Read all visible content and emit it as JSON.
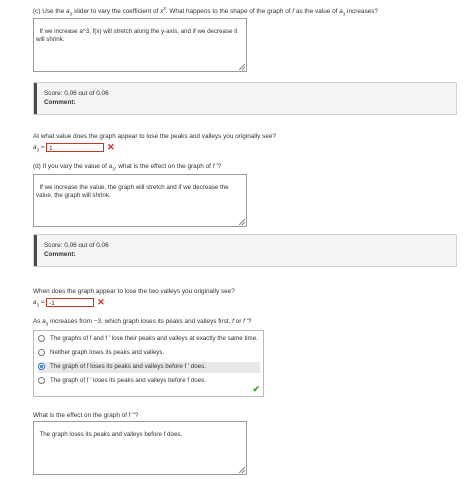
{
  "part_c": {
    "prefix": "(c) Use the ",
    "a": "a",
    "sub": "3",
    "mid": " slider to vary the coefficient of ",
    "x": "x",
    "sup": "3",
    "rest": ". What happens to the shape of the graph of ",
    "f": "f",
    "rest2": " as the value of ",
    "a2": "a",
    "sub2": "3",
    "end": " increases?",
    "answer": "If we increase a^3, f(x) will stretch along the y-axis, and if we decrease it will shrink."
  },
  "score1": {
    "text": "Score: 0.06 out of 0.06",
    "comment_label": "Comment:"
  },
  "q_peaks": {
    "text": "At what value does the graph appear to lose the peaks and valleys you originally see?",
    "var_a": "a",
    "var_sub": "3",
    "approx": " ≈ ",
    "value": "1"
  },
  "part_d": {
    "prefix": "(d) If you vary the value of ",
    "a": "a",
    "sub": "3",
    "mid": ", what is the effect on the graph of ",
    "fp": "f ′",
    "end": "?",
    "answer": "If we increase the value, the graph will stretch and if we decrease the value, the graph will shrink."
  },
  "score2": {
    "text": "Score: 0.06 out of 0.06",
    "comment_label": "Comment:"
  },
  "q_valleys": {
    "text": "When does the graph appear to lose the two valleys you originally see?",
    "var_a": "a",
    "var_sub": "3",
    "approx": " ≈ ",
    "value": "-1"
  },
  "q_mc": {
    "prefix": "As ",
    "a": "a",
    "sub": "3",
    "mid": " increases from −3, which graph loses its peaks and valleys first, ",
    "f": "f",
    "or": " or ",
    "fp": "f ′",
    "end": "?",
    "options": [
      "The graphs of f and f ′ lose their peaks and valleys at exactly the same time.",
      "Neither graph loses its peaks and valleys.",
      "The graph of f loses its peaks and valleys before f ′ does.",
      "The graph of f ′ loses its peaks and valleys before f does."
    ],
    "selected_index": 2
  },
  "q_effect": {
    "text": "What is the effect on the graph of f ′′?",
    "answer": "The graph loses its peaks and valleys before f does."
  }
}
